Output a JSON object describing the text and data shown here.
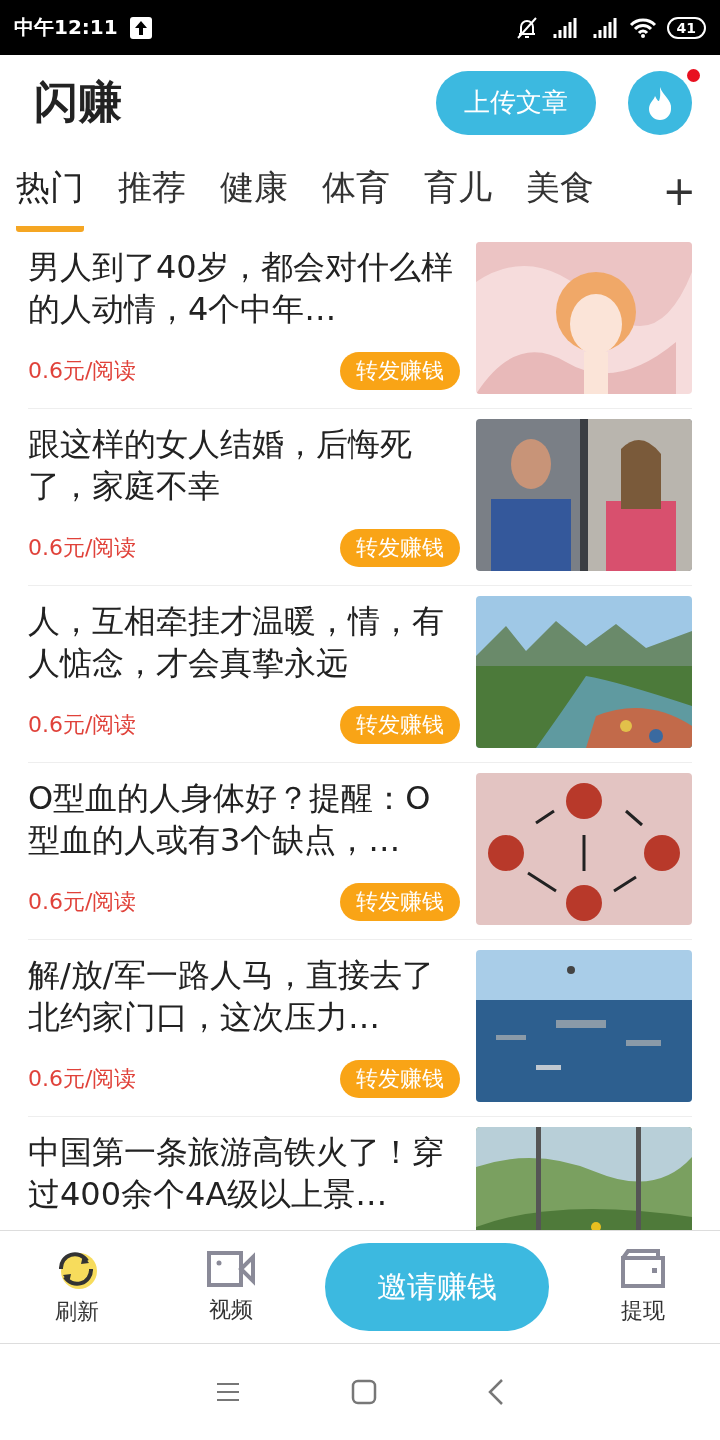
{
  "status_bar": {
    "time": "中午12:11",
    "battery": "41"
  },
  "header": {
    "title": "闪赚",
    "upload_button": "上传文章",
    "notification_dot": true
  },
  "tabs": [
    {
      "label": "热门",
      "selected": true
    },
    {
      "label": "推荐",
      "selected": false
    },
    {
      "label": "健康",
      "selected": false
    },
    {
      "label": "体育",
      "selected": false
    },
    {
      "label": "育儿",
      "selected": false
    },
    {
      "label": "美食",
      "selected": false
    }
  ],
  "add_tab": "+",
  "articles": [
    {
      "title": "男人到了40岁，都会对什么样的人动情，4个中年…",
      "price": "0.6元/阅读",
      "action": "转发赚钱"
    },
    {
      "title": "跟这样的女人结婚，后悔死了，家庭不幸",
      "price": "0.6元/阅读",
      "action": "转发赚钱"
    },
    {
      "title": "人，互相牵挂才温暖，情，有人惦念，才会真挚永远",
      "price": "0.6元/阅读",
      "action": "转发赚钱"
    },
    {
      "title": "O型血的人身体好？提醒：O型血的人或有3个缺点，…",
      "price": "0.6元/阅读",
      "action": "转发赚钱"
    },
    {
      "title": "解/放/军一路人马，直接去了北约家门口，这次压力…",
      "price": "0.6元/阅读",
      "action": "转发赚钱"
    },
    {
      "title": "中国第一条旅游高铁火了！穿过400余个4A级以上景…"
    }
  ],
  "bottom_nav": {
    "items": [
      {
        "label": "刷新",
        "kind": "refresh"
      },
      {
        "label": "视频",
        "kind": "video"
      },
      {
        "label": "邀请赚钱",
        "kind": "invite"
      },
      {
        "label": "提现",
        "kind": "wallet"
      }
    ]
  }
}
